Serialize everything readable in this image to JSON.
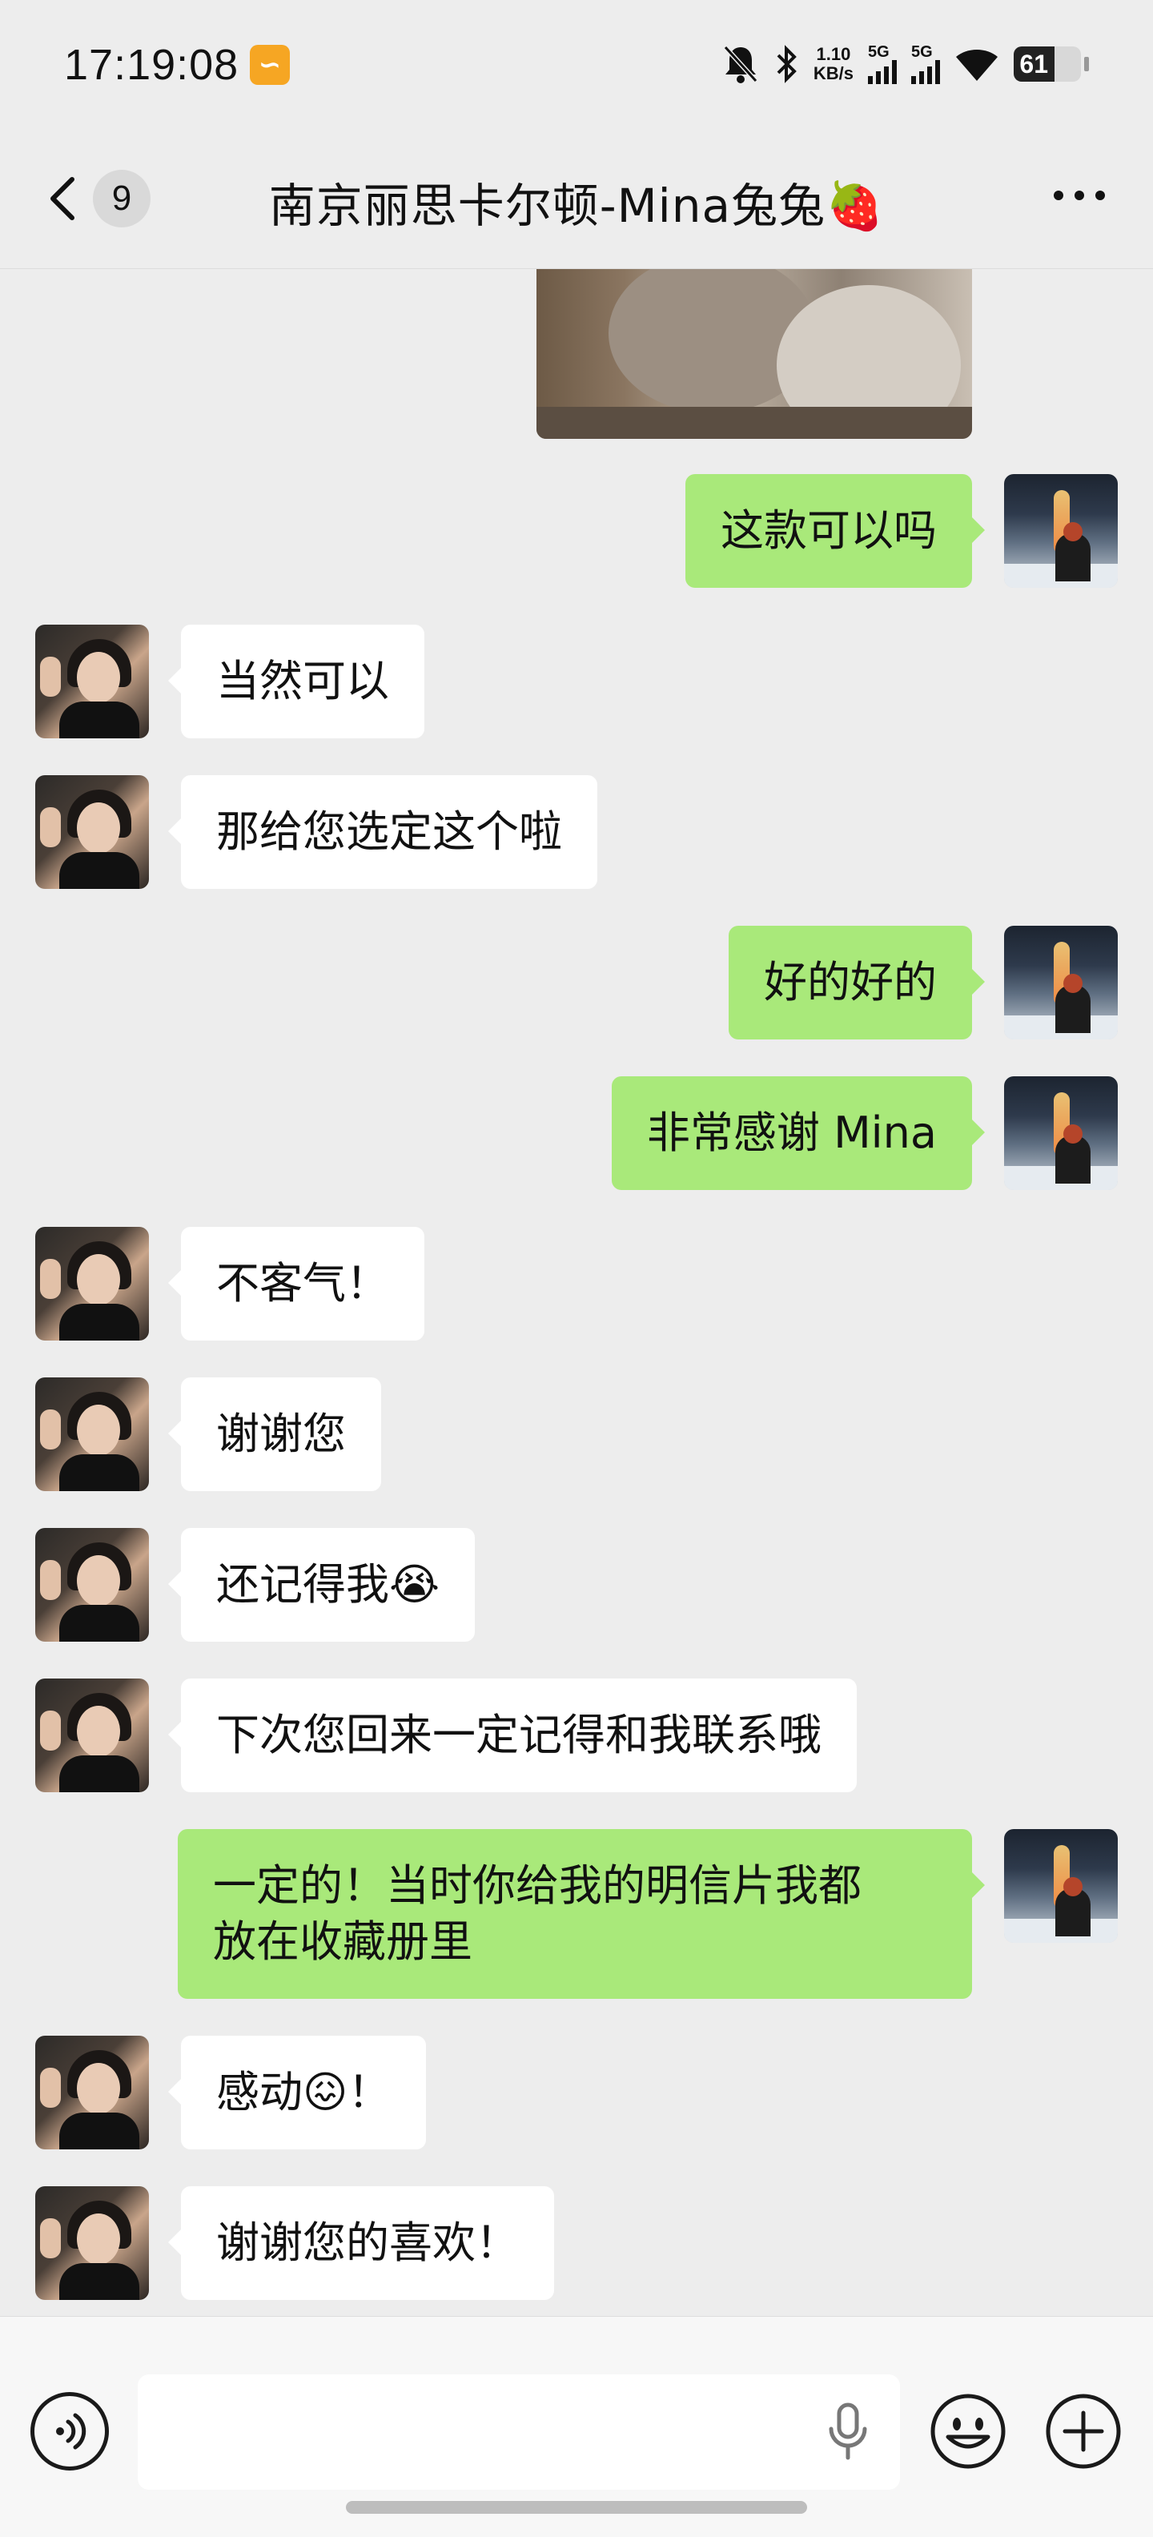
{
  "status_bar": {
    "time": "17:19:08",
    "net_speed_value": "1.10",
    "net_speed_unit": "KB/s",
    "signal1_label": "5G",
    "signal2_label": "5G",
    "battery": "61",
    "icons": [
      "app-notification-icon",
      "mute-bell-icon",
      "bluetooth-icon",
      "signal-icon",
      "wifi-icon",
      "battery-icon"
    ]
  },
  "header": {
    "unread_count": "9",
    "title": "南京丽思卡尔顿-Mina兔兔🍓"
  },
  "messages": [
    {
      "side": "right",
      "text": "这款可以吗"
    },
    {
      "side": "left",
      "text": "当然可以"
    },
    {
      "side": "left",
      "text": "那给您选定这个啦"
    },
    {
      "side": "right",
      "text": "好的好的"
    },
    {
      "side": "right",
      "text": "非常感谢 Mina"
    },
    {
      "side": "left",
      "text": "不客气！"
    },
    {
      "side": "left",
      "text": "谢谢您"
    },
    {
      "side": "left",
      "text": "还记得我😭"
    },
    {
      "side": "left",
      "text": "下次您回来一定记得和我联系哦"
    },
    {
      "side": "right",
      "text": "一定的！当时你给我的明信片我都\n放在收藏册里"
    },
    {
      "side": "left",
      "text": "感动😖！"
    },
    {
      "side": "left",
      "text": "谢谢您的喜欢！"
    }
  ],
  "input_bar": {
    "value": "",
    "placeholder": ""
  },
  "colors": {
    "background": "#ededed",
    "bubble_self": "#a9e97a",
    "bubble_other": "#ffffff"
  }
}
